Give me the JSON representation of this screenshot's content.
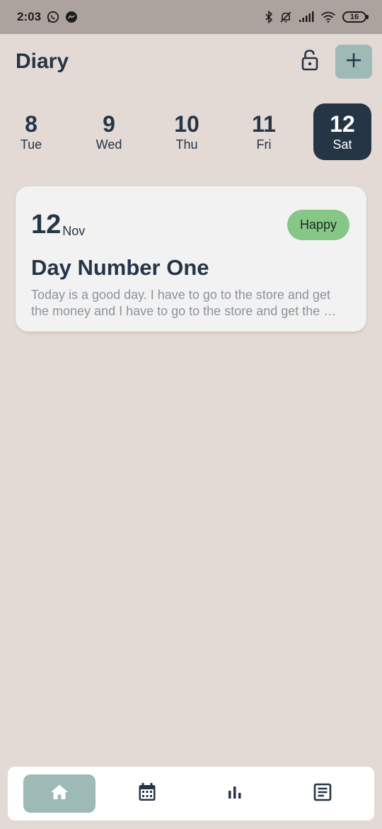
{
  "status_bar": {
    "time": "2:03",
    "battery": "16",
    "left_icons": [
      "whatsapp-icon",
      "messenger-icon"
    ],
    "right_icons": [
      "bluetooth-icon",
      "alarm-off-icon",
      "signal-icon",
      "wifi-icon",
      "battery-icon"
    ]
  },
  "header": {
    "title": "Diary",
    "lock_icon": "lock-open-icon",
    "add_icon": "plus-icon"
  },
  "days": [
    {
      "num": "8",
      "dow": "Tue",
      "selected": false
    },
    {
      "num": "9",
      "dow": "Wed",
      "selected": false
    },
    {
      "num": "10",
      "dow": "Thu",
      "selected": false
    },
    {
      "num": "11",
      "dow": "Fri",
      "selected": false
    },
    {
      "num": "12",
      "dow": "Sat",
      "selected": true
    }
  ],
  "entries": [
    {
      "day": "12",
      "month": "Nov",
      "mood": "Happy",
      "title": "Day Number One",
      "preview": "Today is a good day. I have to go to the store and get the money and I have to go to the store and get the …"
    }
  ],
  "bottom_nav": [
    {
      "icon": "home-icon",
      "active": true
    },
    {
      "icon": "calendar-icon",
      "active": false
    },
    {
      "icon": "stats-icon",
      "active": false
    },
    {
      "icon": "notes-icon",
      "active": false
    }
  ],
  "colors": {
    "background": "#e3dad5",
    "accent": "#9dbab6",
    "primary_dark": "#253546",
    "mood_happy": "#86c686",
    "card": "#f2f2f2"
  }
}
